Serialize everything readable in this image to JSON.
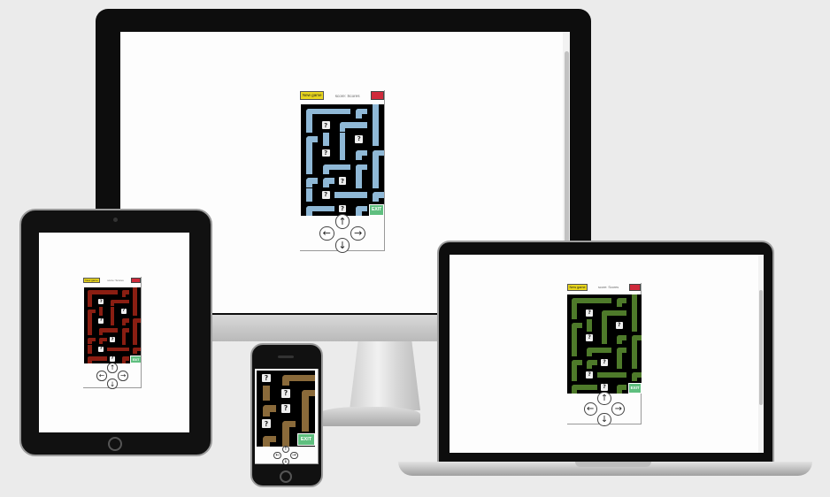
{
  "games": {
    "desktop": {
      "new_game_label": "New game",
      "score_text": "score: Scores",
      "exit_label": "EXIT",
      "pipe_color": "#8fb8d6",
      "controls": {
        "up": "↑",
        "left": "←",
        "right": "→",
        "down": "↓"
      }
    },
    "tablet": {
      "new_game_label": "New game",
      "score_text": "score: Scores",
      "exit_label": "EXIT",
      "pipe_color": "#8a1e12",
      "controls": {
        "up": "↑",
        "left": "←",
        "right": "→",
        "down": "↓"
      }
    },
    "laptop": {
      "new_game_label": "New game",
      "score_text": "score: Scores",
      "exit_label": "EXIT",
      "pipe_color": "#4e7a2a",
      "controls": {
        "up": "↑",
        "left": "←",
        "right": "→",
        "down": "↓"
      }
    },
    "phone": {
      "exit_label": "EXIT",
      "pipe_color": "#8a6a3a",
      "controls": {
        "up": "↑",
        "left": "←",
        "right": "→",
        "down": "↓"
      }
    }
  },
  "qmark_symbol": "?",
  "colors": {
    "new_game_button": "#e8d51c",
    "red_button": "#cf2a3b",
    "board_bg": "#000000",
    "exit_tile": "#5fbf7f"
  }
}
